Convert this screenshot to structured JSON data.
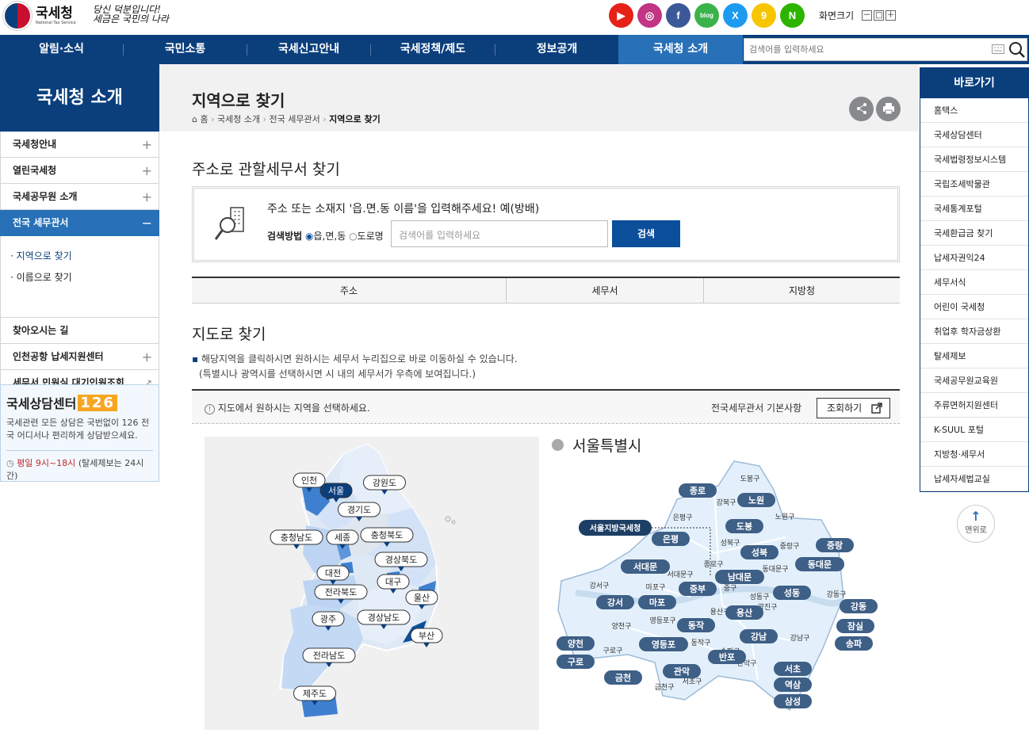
{
  "logo": {
    "name": "국세청",
    "en": "National Tax Service",
    "slogan_1": "당신 덕분입니다!",
    "slogan_2": "세금은 국민의 나라"
  },
  "sns": [
    {
      "name": "youtube-icon",
      "g": "▶",
      "c": "#e62117"
    },
    {
      "name": "instagram-icon",
      "g": "◎",
      "c": "#c13584"
    },
    {
      "name": "facebook-icon",
      "g": "f",
      "c": "#3b5998"
    },
    {
      "name": "blog-icon",
      "g": "blog",
      "c": "#3bb34a"
    },
    {
      "name": "x-icon",
      "g": "X",
      "c": "#1d9bf0"
    },
    {
      "name": "kakao-story-icon",
      "g": "9",
      "c": "#f7c600"
    },
    {
      "name": "naver-post-icon",
      "g": "N",
      "c": "#2db400"
    }
  ],
  "fontsize": {
    "label": "화면크기",
    "minus": "－",
    "reset": "□",
    "plus": "＋"
  },
  "gnb": [
    "알림·소식",
    "국민소통",
    "국세신고안내",
    "국세정책/제도",
    "정보공개",
    "국세청 소개"
  ],
  "search": {
    "placeholder": "검색어를 입력하세요"
  },
  "lnb": {
    "title": "국세청 소개",
    "items": [
      {
        "label": "국세청안내",
        "mark": "+"
      },
      {
        "label": "열린국세청",
        "mark": "+"
      },
      {
        "label": "국세공무원 소개",
        "mark": "+"
      },
      {
        "label": "전국 세무관서",
        "mark": "−"
      }
    ],
    "sub": [
      "· 지역으로 찾기",
      "· 이름으로 찾기"
    ],
    "items2": [
      {
        "label": "찾아오시는 길",
        "mark": ""
      },
      {
        "label": "인천공항 납세지원센터",
        "mark": "+"
      },
      {
        "label": "세무서 민원실 대기인원조회",
        "mark": "↗"
      }
    ]
  },
  "callcenter": {
    "title": "국세상담센터",
    "num": "126",
    "desc": "국세관련 모든 상담은 국번없이 126 전국 어디서나 편리하게 상담받으세요.",
    "hours": "평일 9시~18시",
    "hours_note": "(탈세제보는 24시간)"
  },
  "page": {
    "title": "지역으로 찾기",
    "crumb": [
      "홈",
      "국세청 소개",
      "전국 세무관서",
      "지역으로 찾기"
    ]
  },
  "addr": {
    "heading": "주소로 관할세무서 찾기",
    "question": "주소 또는 소재지 '읍.면.동 이름'을 입력해주세요! 예(방배)",
    "method_label": "검색방법",
    "opt1": "읍,면,동",
    "opt2": "도로명",
    "placeholder": "검색어를 입력하세요",
    "button": "검색"
  },
  "tabs": [
    "주소",
    "세무서",
    "지방청"
  ],
  "map": {
    "heading": "지도로 찾기",
    "desc1": "해당지역을 클릭하시면 원하시는 세무서 누리집으로 바로 이동하실 수 있습니다.",
    "desc2": "(특별시나 광역시를 선택하시면 시 내의 세무서가 우측에 보여집니다.)",
    "hint": "지도에서 원하시는 지역을 선택하세요.",
    "basic": "전국세무관서 기본사항",
    "button": "조회하기",
    "city": "서울특별시",
    "hq": "서울지방국세청"
  },
  "regions": [
    {
      "n": "인천"
    },
    {
      "n": "서울",
      "on": true
    },
    {
      "n": "강원도"
    },
    {
      "n": "경기도"
    },
    {
      "n": "충청남도"
    },
    {
      "n": "세종"
    },
    {
      "n": "충청북도"
    },
    {
      "n": "경상북도"
    },
    {
      "n": "대전"
    },
    {
      "n": "대구"
    },
    {
      "n": "전라북도"
    },
    {
      "n": "울산"
    },
    {
      "n": "광주"
    },
    {
      "n": "경상남도"
    },
    {
      "n": "부산"
    },
    {
      "n": "전라남도"
    },
    {
      "n": "제주도"
    }
  ],
  "offices": [
    "종로",
    "노원",
    "도봉",
    "은평",
    "성북",
    "중랑",
    "서대문",
    "남대문",
    "동대문",
    "중부",
    "성동",
    "강동",
    "강서",
    "마포",
    "용산",
    "잠실",
    "양천",
    "동작",
    "강남",
    "송파",
    "영등포",
    "반포",
    "구로",
    "서초",
    "관악",
    "역삼",
    "금천",
    "삼성"
  ],
  "gu": [
    "도봉구",
    "강북구",
    "노원구",
    "은평구",
    "성북구",
    "중랑구",
    "종로구",
    "동대문구",
    "서대문구",
    "중구",
    "강서구",
    "마포구",
    "성동구",
    "광진구",
    "용산구",
    "양천구",
    "영등포구",
    "동작구",
    "강남구",
    "송파구",
    "구로구",
    "관악구",
    "서초구",
    "금천구",
    "강동구"
  ],
  "quick": {
    "title": "바로가기",
    "items": [
      "홈택스",
      "국세상담센터",
      "국세법령정보시스템",
      "국립조세박물관",
      "국세통계포털",
      "국세환급금 찾기",
      "납세자권익24",
      "세무서식",
      "어린이 국세청",
      "취업후 학자금상환",
      "탈세제보",
      "국세공무원교육원",
      "주류면허지원센터",
      "K-SUUL 포털",
      "지방청·세무서",
      "납세자세법교실"
    ]
  },
  "totop": "맨위로"
}
